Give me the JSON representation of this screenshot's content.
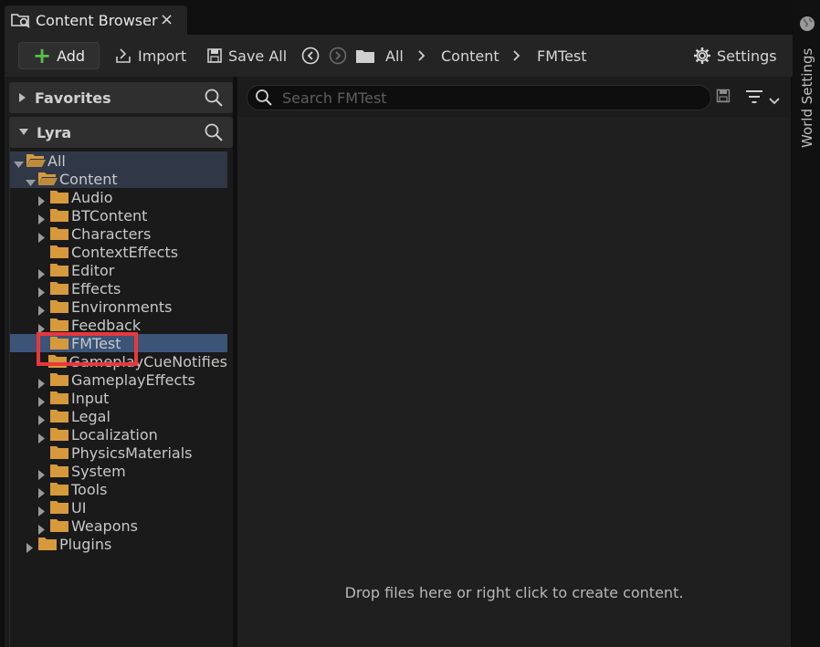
{
  "tab": {
    "title": "Content Browser",
    "close": "×"
  },
  "toolbar": {
    "add_label": "Add",
    "import_label": "Import",
    "save_all_label": "Save All",
    "breadcrumb": [
      "All",
      "Content",
      "FMTest"
    ],
    "settings_label": "Settings"
  },
  "sidebar": {
    "favorites_label": "Favorites",
    "lyra_label": "Lyra",
    "tree": [
      {
        "label": "All",
        "level": 0,
        "expanded": true,
        "has_children": true
      },
      {
        "label": "Content",
        "level": 1,
        "expanded": true,
        "has_children": true
      },
      {
        "label": "Audio",
        "level": 2,
        "has_children": true
      },
      {
        "label": "BTContent",
        "level": 2,
        "has_children": true
      },
      {
        "label": "Characters",
        "level": 2,
        "has_children": true
      },
      {
        "label": "ContextEffects",
        "level": 2,
        "has_children": false
      },
      {
        "label": "Editor",
        "level": 2,
        "has_children": true
      },
      {
        "label": "Effects",
        "level": 2,
        "has_children": true
      },
      {
        "label": "Environments",
        "level": 2,
        "has_children": true
      },
      {
        "label": "Feedback",
        "level": 2,
        "has_children": true
      },
      {
        "label": "FMTest",
        "level": 2,
        "has_children": false,
        "selected": true
      },
      {
        "label": "GameplayCueNotifies",
        "level": 2,
        "has_children": false
      },
      {
        "label": "GameplayEffects",
        "level": 2,
        "has_children": true
      },
      {
        "label": "Input",
        "level": 2,
        "has_children": true
      },
      {
        "label": "Legal",
        "level": 2,
        "has_children": true
      },
      {
        "label": "Localization",
        "level": 2,
        "has_children": true
      },
      {
        "label": "PhysicsMaterials",
        "level": 2,
        "has_children": false
      },
      {
        "label": "System",
        "level": 2,
        "has_children": true
      },
      {
        "label": "Tools",
        "level": 2,
        "has_children": true
      },
      {
        "label": "UI",
        "level": 2,
        "has_children": true
      },
      {
        "label": "Weapons",
        "level": 2,
        "has_children": true
      },
      {
        "label": "Plugins",
        "level": 1,
        "has_children": true
      }
    ]
  },
  "main": {
    "search_placeholder": "Search FMTest",
    "empty_message": "Drop files here or right click to create content."
  },
  "side_panel": {
    "label": "World Settings"
  },
  "colors": {
    "accent_green": "#56c24a",
    "folder": "#d69a3c",
    "selection": "#3b5478",
    "highlight_box": "#e8383c"
  }
}
